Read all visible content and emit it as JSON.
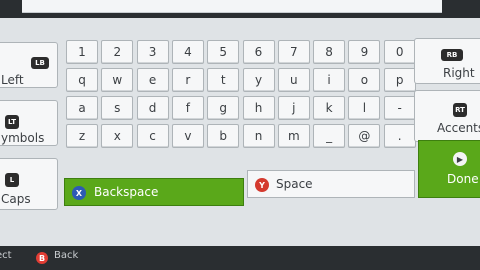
{
  "keyboard": {
    "rows": [
      [
        "1",
        "2",
        "3",
        "4",
        "5",
        "6",
        "7",
        "8",
        "9",
        "0"
      ],
      [
        "q",
        "w",
        "e",
        "r",
        "t",
        "y",
        "u",
        "i",
        "o",
        "p"
      ],
      [
        "a",
        "s",
        "d",
        "f",
        "g",
        "h",
        "j",
        "k",
        "l",
        "-"
      ],
      [
        "z",
        "x",
        "c",
        "v",
        "b",
        "n",
        "m",
        "_",
        "@",
        "."
      ]
    ]
  },
  "left_buttons": {
    "left": {
      "badge": "LB",
      "label": "Left"
    },
    "symbols": {
      "badge": "LT",
      "label": "ymbols"
    },
    "caps": {
      "badge": "L",
      "label": "Caps"
    }
  },
  "right_buttons": {
    "right": {
      "badge": "RB",
      "label": "Right"
    },
    "accents": {
      "badge": "RT",
      "label": "Accents"
    },
    "done": {
      "label": "Done"
    }
  },
  "actions": {
    "backspace": {
      "button": "X",
      "label": "Backspace"
    },
    "space": {
      "button": "Y",
      "label": "Space"
    }
  },
  "footer": {
    "select_label": "ect",
    "back_button": "B",
    "back_label": "Back"
  },
  "colors": {
    "accent_green": "#5aa81a",
    "x_button_blue": "#2e5ab5",
    "y_button_red": "#d43a2e",
    "b_button_red": "#e23d34"
  }
}
